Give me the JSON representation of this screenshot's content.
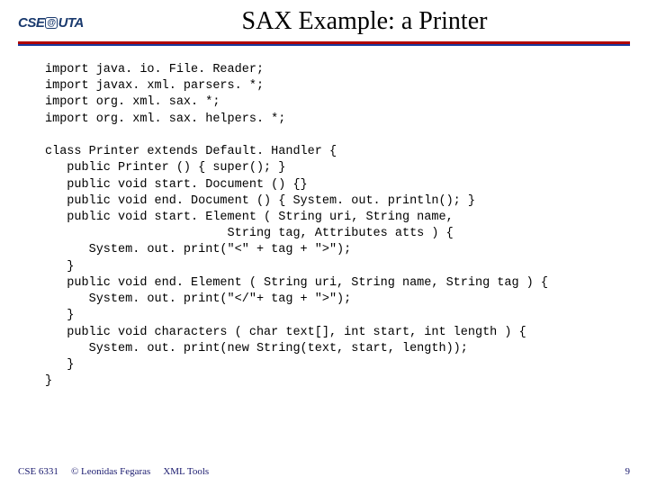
{
  "logo": {
    "prefix": "CSE",
    "at": "@",
    "suffix": "UTA"
  },
  "title": "SAX Example: a Printer",
  "code_lines": [
    "import java. io. File. Reader;",
    "import javax. xml. parsers. *;",
    "import org. xml. sax. *;",
    "import org. xml. sax. helpers. *;",
    "",
    "class Printer extends Default. Handler {",
    "   public Printer () { super(); }",
    "   public void start. Document () {}",
    "   public void end. Document () { System. out. println(); }",
    "   public void start. Element ( String uri, String name,",
    "                         String tag, Attributes atts ) {",
    "      System. out. print(\"<\" + tag + \">\");",
    "   }",
    "   public void end. Element ( String uri, String name, String tag ) {",
    "      System. out. print(\"</\"+ tag + \">\");",
    "   }",
    "   public void characters ( char text[], int start, int length ) {",
    "      System. out. print(new String(text, start, length));",
    "   }",
    "}"
  ],
  "footer": {
    "course": "CSE 6331",
    "copyright": "© Leonidas Fegaras",
    "topic": "XML Tools",
    "page": "9"
  }
}
